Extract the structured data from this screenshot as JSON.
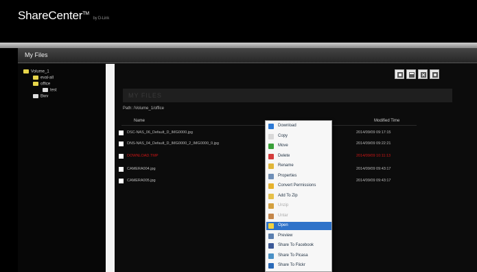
{
  "app": {
    "brand": "ShareCenter",
    "tm": "TM",
    "by": "by D-Link"
  },
  "window": {
    "title": "My Files"
  },
  "tree": {
    "items": [
      {
        "label": "Volume_1"
      },
      {
        "label": "eval-all"
      },
      {
        "label": "office"
      },
      {
        "label": "test"
      },
      {
        "label": "Bwv"
      }
    ]
  },
  "toolbar": {
    "icons": [
      "upload-icon",
      "new-folder-icon",
      "download-icon",
      "settings-icon"
    ]
  },
  "pane": {
    "title": "MY FILES"
  },
  "path": "Path: /Volume_1/office",
  "table": {
    "col_name": "Name",
    "col_time": "Modified Time",
    "rows": [
      {
        "name": "DSC-NAS_06_Default_D_IMG0000.jpg",
        "size": "",
        "time": "2014/09/09 09:17:15"
      },
      {
        "name": "DNS-NAS_04_Default_D_IMG0000_2_IMG0000_0.jpg",
        "size": "",
        "time": "2014/09/09 09:22:21"
      },
      {
        "name": "DOWNLOAD.TMP",
        "size": "",
        "time": "2014/09/09 10:11:13"
      },
      {
        "name": "CAMERA004.jpg",
        "size": "",
        "time": "2014/09/09 09:43:17"
      },
      {
        "name": "CAMERA005.jpg",
        "size": "",
        "time": "2014/09/09 09:43:17"
      }
    ]
  },
  "menu": {
    "items": [
      {
        "label": "Download",
        "icon": "download-icon",
        "color": "#2e7ad6"
      },
      {
        "label": "Copy",
        "icon": "copy-icon",
        "color": "#d8d8d8"
      },
      {
        "label": "Move",
        "icon": "move-icon",
        "color": "#3aa03a"
      },
      {
        "label": "Delete",
        "icon": "delete-icon",
        "color": "#d43c3c"
      },
      {
        "label": "Rename",
        "icon": "rename-icon",
        "color": "#e0b63a"
      },
      {
        "label": "Properties",
        "icon": "properties-icon",
        "color": "#6f8fb8"
      },
      {
        "label": "Convert Permissions",
        "icon": "permissions-icon",
        "color": "#e6b22d"
      },
      {
        "label": "Add To Zip",
        "icon": "zip-icon",
        "color": "#e6c04a"
      },
      {
        "label": "Unzip",
        "icon": "unzip-icon",
        "color": "#d3a040"
      },
      {
        "label": "Untar",
        "icon": "untar-icon",
        "color": "#c4874a"
      },
      {
        "label": "Open",
        "icon": "open-icon",
        "color": "#f2d23e"
      },
      {
        "label": "Preview",
        "icon": "preview-icon",
        "color": "#5a7fb0"
      },
      {
        "label": "Share To Facebook",
        "icon": "facebook-icon",
        "color": "#3b5998"
      },
      {
        "label": "Share To Picasa",
        "icon": "picasa-icon",
        "color": "#4a90c6"
      },
      {
        "label": "Share To Flickr",
        "icon": "flickr-icon",
        "color": "#2a6ab8"
      }
    ],
    "active_index": 10,
    "disabled": [
      8,
      9
    ]
  }
}
